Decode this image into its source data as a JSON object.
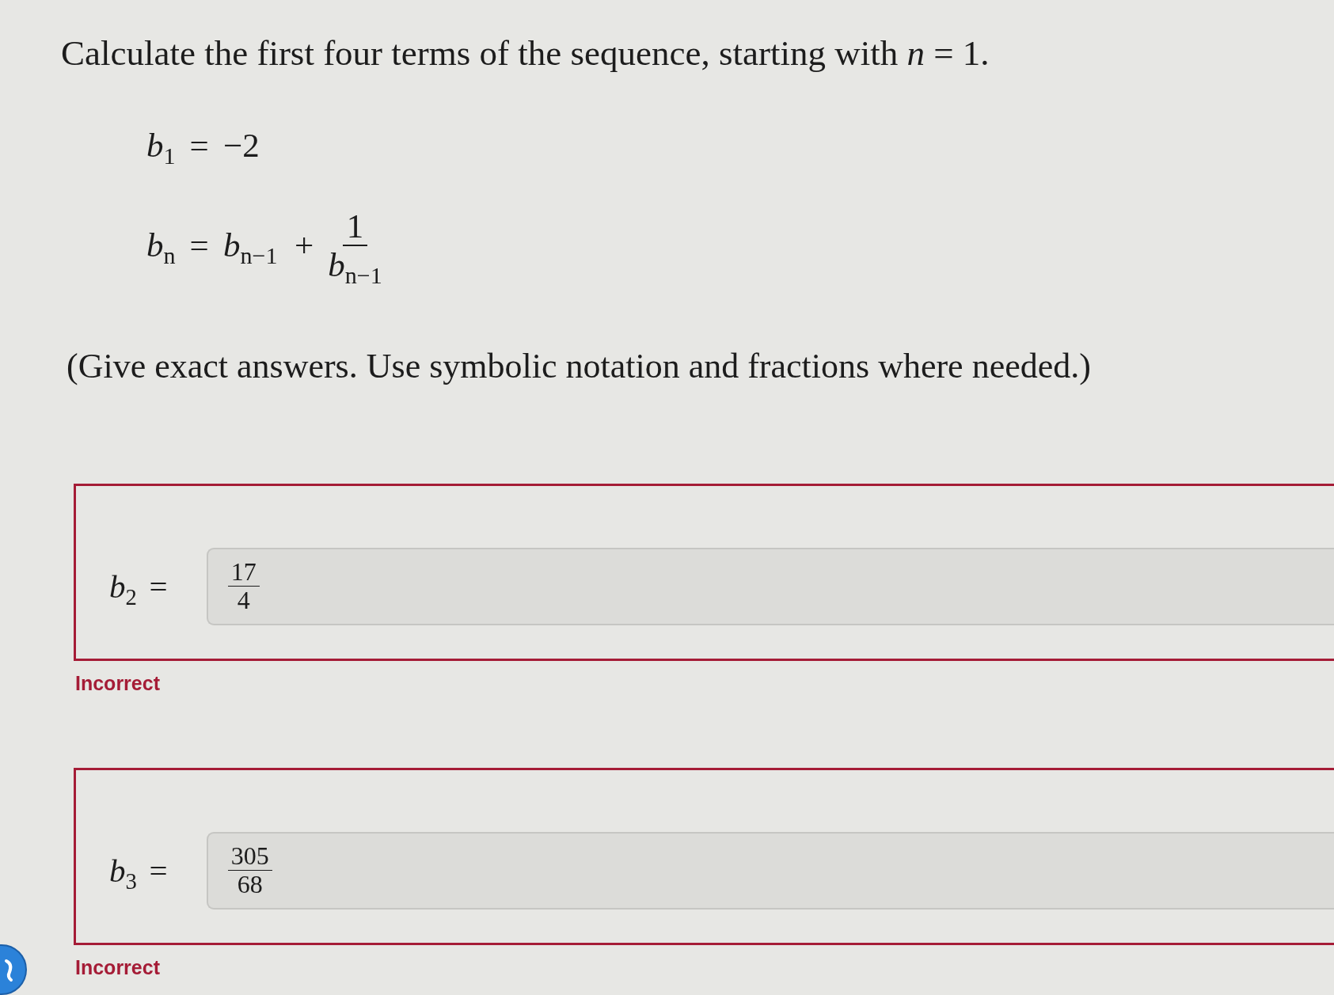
{
  "problem": {
    "prompt": "Calculate the first four terms of the sequence, starting with *n* = 1.",
    "equations": [
      {
        "kind": "plain",
        "lhs": "*b*$_{1}$",
        "relation": "=",
        "rhs": "−2"
      },
      {
        "kind": "fraction",
        "lhs": "*b*$_{n}$",
        "relation": "=",
        "rhs": "*b*$_{n−1}$ +",
        "numerator": "1",
        "denominator": "*b*$_{n−1}$"
      }
    ],
    "instructions": "(Give exact answers. Use symbolic notation and fractions where needed.)"
  },
  "answers": [
    {
      "label": "*b*$_{2}$",
      "relation": "=",
      "value": {
        "numerator": "17",
        "denominator": "4"
      },
      "correct": false,
      "feedback": "Incorrect"
    },
    {
      "label": "*b*$_{3}$",
      "relation": "=",
      "value": {
        "numerator": "305",
        "denominator": "68"
      },
      "correct": false,
      "feedback": "Incorrect"
    }
  ]
}
